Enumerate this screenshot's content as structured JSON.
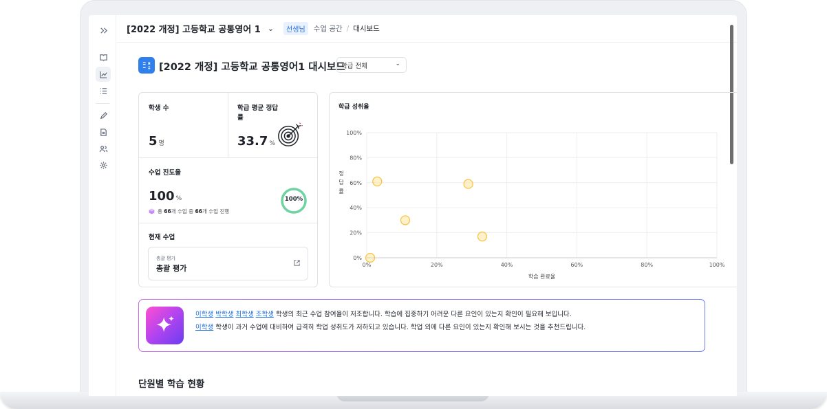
{
  "header": {
    "course_title": "[2022 개정] 고등학교 공통영어 1",
    "role_badge": "선생님",
    "breadcrumb_space": "수업 공간",
    "breadcrumb_sep": "/",
    "breadcrumb_current": "대시보드"
  },
  "page": {
    "title": "[2022 개정] 고등학교 공통영어1 대시보드",
    "class_filter": "학급 전체"
  },
  "stats": {
    "students_label": "학생 수",
    "students_value": "5",
    "students_unit": "명",
    "accuracy_label_1": "학급 평균 정답",
    "accuracy_label_2": "률",
    "accuracy_value": "33.7",
    "accuracy_unit": "%",
    "progress_label": "수업 진도율",
    "progress_value": "100",
    "progress_unit": "%",
    "progress_ring_text": "100%",
    "progress_fraction": 1.0,
    "progress_note_pre": "총",
    "progress_total": "66",
    "progress_note_mid": "개 수업 중",
    "progress_done": "66",
    "progress_note_post": "개 수업 진행",
    "current_lesson_label": "현재 수업",
    "current_lesson_small": "총괄 평가",
    "current_lesson_title": "총괄 평가"
  },
  "chart_data": {
    "type": "scatter",
    "title": "학급 성취율",
    "xlabel": "학습 완료율",
    "ylabel": "정답률",
    "xlim": [
      0,
      100
    ],
    "ylim": [
      0,
      100
    ],
    "x_ticks": [
      "0%",
      "20%",
      "40%",
      "60%",
      "80%",
      "100%"
    ],
    "y_ticks": [
      "0%",
      "20%",
      "40%",
      "60%",
      "80%",
      "100%"
    ],
    "grid": true,
    "points": [
      {
        "x": 1,
        "y": 0
      },
      {
        "x": 3,
        "y": 61
      },
      {
        "x": 11,
        "y": 30
      },
      {
        "x": 29,
        "y": 59
      },
      {
        "x": 33,
        "y": 17
      }
    ],
    "marker_color": "#f5c64a"
  },
  "insight": {
    "students_1": [
      "이학생",
      "박학생",
      "최학생",
      "조학생"
    ],
    "message_1": "학생의 최근 수업 참여율이 저조합니다. 학습에 집중하기 어려운 다른 요인이 있는지 확인이 필요해 보입니다.",
    "students_2": [
      "이학생"
    ],
    "message_2": "학생이 과거 수업에 대비하여 급격히 학업 성취도가 저하되고 있습니다. 학업 외에 다른 요인이 있는지 확인해 보시는 것을 추천드립니다."
  },
  "section": {
    "unit_status_title": "단원별 학습 현황"
  },
  "colors": {
    "accent": "#2f80ed",
    "progress_ring": "#6fd3a1",
    "link": "#1e6fd9"
  }
}
